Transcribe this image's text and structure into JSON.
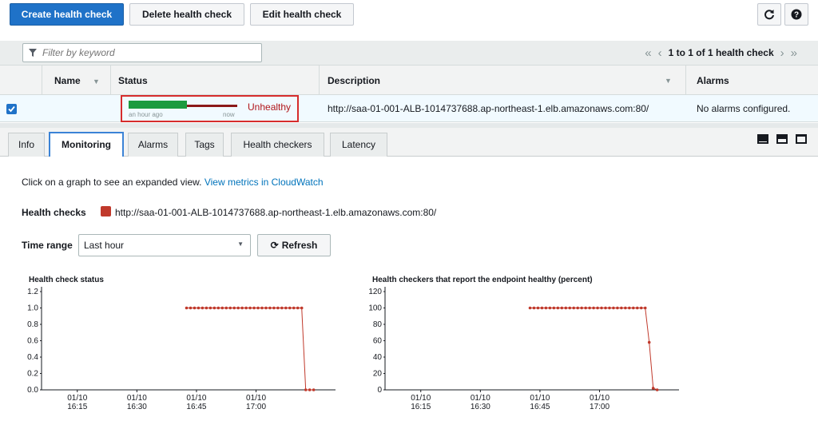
{
  "toolbar": {
    "create_label": "Create health check",
    "delete_label": "Delete health check",
    "edit_label": "Edit health check"
  },
  "filter": {
    "placeholder": "Filter by keyword"
  },
  "pager": {
    "text": "1 to 1 of 1 health check"
  },
  "table": {
    "headers": {
      "name": "Name",
      "status": "Status",
      "description": "Description",
      "alarms": "Alarms"
    },
    "rows": [
      {
        "checked": true,
        "name": "",
        "status_text": "Unhealthy",
        "status_bar": {
          "healthy_fraction": 0.54,
          "start_label": "an hour ago",
          "end_label": "now"
        },
        "description": "http://saa-01-001-ALB-1014737688.ap-northeast-1.elb.amazonaws.com:80/",
        "alarms": "No alarms configured."
      }
    ]
  },
  "tabs": [
    {
      "label": "Info",
      "active": false
    },
    {
      "label": "Monitoring",
      "active": true
    },
    {
      "label": "Alarms",
      "active": false
    },
    {
      "label": "Tags",
      "active": false
    },
    {
      "label": "Health checkers",
      "active": false
    },
    {
      "label": "Latency",
      "active": false
    }
  ],
  "monitoring": {
    "intro_text": "Click on a graph to see an expanded view.",
    "cloudwatch_link": "View metrics in CloudWatch",
    "health_checks_label": "Health checks",
    "health_check_url": "http://saa-01-001-ALB-1014737688.ap-northeast-1.elb.amazonaws.com:80/",
    "time_range_label": "Time range",
    "time_range_value": "Last hour",
    "refresh_label": "Refresh"
  },
  "colors": {
    "primary_button": "#1f72c8",
    "healthy_green": "#1d9b3e",
    "unhealthy_red": "#8b1a1a",
    "highlight_box": "#d62c2c",
    "series_color": "#c0392b",
    "link": "#0073bb"
  },
  "chart_data": [
    {
      "type": "line",
      "title": "Health check status",
      "ylim": [
        0,
        1.2
      ],
      "yticks": [
        "0.0",
        "0.2",
        "0.4",
        "0.6",
        "0.8",
        "1.0",
        "1.2"
      ],
      "xticks": [
        {
          "date": "01/10",
          "time": "16:15"
        },
        {
          "date": "01/10",
          "time": "16:30"
        },
        {
          "date": "01/10",
          "time": "16:45"
        },
        {
          "date": "01/10",
          "time": "17:00"
        }
      ],
      "xlim": [
        "16:06",
        "17:20"
      ],
      "series": [
        {
          "x": [
            "16:42:30",
            "16:43:30",
            "16:44:30",
            "16:45:30",
            "16:46:30",
            "16:47:30",
            "16:48:30",
            "16:49:30",
            "16:50:30",
            "16:51:30",
            "16:52:30",
            "16:53:30",
            "16:54:30",
            "16:55:30",
            "16:56:30",
            "16:57:30",
            "16:58:30",
            "16:59:30",
            "17:00:30",
            "17:01:30",
            "17:02:30",
            "17:03:30",
            "17:04:30",
            "17:05:30",
            "17:06:30",
            "17:07:30",
            "17:08:30",
            "17:09:30",
            "17:10:30",
            "17:11:30",
            "17:12:30",
            "17:13:30",
            "17:14:30"
          ],
          "y": [
            1,
            1,
            1,
            1,
            1,
            1,
            1,
            1,
            1,
            1,
            1,
            1,
            1,
            1,
            1,
            1,
            1,
            1,
            1,
            1,
            1,
            1,
            1,
            1,
            1,
            1,
            1,
            1,
            1,
            1,
            0,
            0,
            0
          ]
        }
      ]
    },
    {
      "type": "line",
      "title": "Health checkers that report the endpoint healthy (percent)",
      "ylim": [
        0,
        120
      ],
      "yticks": [
        "0",
        "20",
        "40",
        "60",
        "80",
        "100",
        "120"
      ],
      "xticks": [
        {
          "date": "01/10",
          "time": "16:15"
        },
        {
          "date": "01/10",
          "time": "16:30"
        },
        {
          "date": "01/10",
          "time": "16:45"
        },
        {
          "date": "01/10",
          "time": "17:00"
        }
      ],
      "xlim": [
        "16:06",
        "17:20"
      ],
      "series": [
        {
          "x": [
            "16:42:30",
            "16:43:30",
            "16:44:30",
            "16:45:30",
            "16:46:30",
            "16:47:30",
            "16:48:30",
            "16:49:30",
            "16:50:30",
            "16:51:30",
            "16:52:30",
            "16:53:30",
            "16:54:30",
            "16:55:30",
            "16:56:30",
            "16:57:30",
            "16:58:30",
            "16:59:30",
            "17:00:30",
            "17:01:30",
            "17:02:30",
            "17:03:30",
            "17:04:30",
            "17:05:30",
            "17:06:30",
            "17:07:30",
            "17:08:30",
            "17:09:30",
            "17:10:30",
            "17:11:30",
            "17:12:30",
            "17:13:30",
            "17:14:30"
          ],
          "y": [
            100,
            100,
            100,
            100,
            100,
            100,
            100,
            100,
            100,
            100,
            100,
            100,
            100,
            100,
            100,
            100,
            100,
            100,
            100,
            100,
            100,
            100,
            100,
            100,
            100,
            100,
            100,
            100,
            100,
            100,
            58,
            2,
            0
          ]
        }
      ]
    }
  ]
}
